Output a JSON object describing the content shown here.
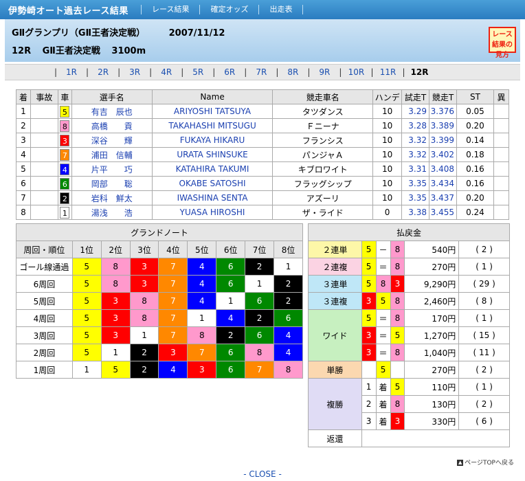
{
  "topbar": {
    "title": "伊勢崎オート過去レース結果",
    "links": [
      "レース結果",
      "確定オッズ",
      "出走表"
    ]
  },
  "header": {
    "event": "GⅡグランプリ（GⅡ王者決定戦）",
    "date": "2007/11/12",
    "race_no": "12R",
    "race_name": "GⅡ王者決定戦",
    "distance": "3100m",
    "guide_button": "レース結果の見方"
  },
  "races": [
    "1R",
    "2R",
    "3R",
    "4R",
    "5R",
    "6R",
    "7R",
    "8R",
    "9R",
    "10R",
    "11R",
    "12R"
  ],
  "current_race": "12R",
  "result": {
    "headers": [
      "着",
      "事故",
      "車",
      "選手名",
      "Name",
      "競走車名",
      "ハンデ",
      "試走T",
      "競走T",
      "ST",
      "異"
    ],
    "rows": [
      {
        "pos": "1",
        "acc": "",
        "car": "5",
        "rider": "有吉　辰也",
        "name": "ARIYOSHI TATSUYA",
        "machine": "タツダンス",
        "hande": "10",
        "trial": "3.29",
        "race": "3.376",
        "st": "0.05",
        "note": ""
      },
      {
        "pos": "2",
        "acc": "",
        "car": "8",
        "rider": "高橋　　貢",
        "name": "TAKAHASHI MITSUGU",
        "machine": "Ｆニーナ",
        "hande": "10",
        "trial": "3.28",
        "race": "3.389",
        "st": "0.20",
        "note": ""
      },
      {
        "pos": "3",
        "acc": "",
        "car": "3",
        "rider": "深谷　　輝",
        "name": "FUKAYA HIKARU",
        "machine": "フランシス",
        "hande": "10",
        "trial": "3.32",
        "race": "3.399",
        "st": "0.14",
        "note": ""
      },
      {
        "pos": "4",
        "acc": "",
        "car": "7",
        "rider": "浦田　信輔",
        "name": "URATA SHINSUKE",
        "machine": "パンジャＡ",
        "hande": "10",
        "trial": "3.32",
        "race": "3.402",
        "st": "0.18",
        "note": ""
      },
      {
        "pos": "5",
        "acc": "",
        "car": "4",
        "rider": "片平　　巧",
        "name": "KATAHIRA TAKUMI",
        "machine": "キブロワイト",
        "hande": "10",
        "trial": "3.31",
        "race": "3.408",
        "st": "0.16",
        "note": ""
      },
      {
        "pos": "6",
        "acc": "",
        "car": "6",
        "rider": "岡部　　聡",
        "name": "OKABE SATOSHI",
        "machine": "フラッグシップ",
        "hande": "10",
        "trial": "3.35",
        "race": "3.434",
        "st": "0.16",
        "note": ""
      },
      {
        "pos": "7",
        "acc": "",
        "car": "2",
        "rider": "岩科　鮮太",
        "name": "IWASHINA SENTA",
        "machine": "アズーリ",
        "hande": "10",
        "trial": "3.35",
        "race": "3.437",
        "st": "0.20",
        "note": ""
      },
      {
        "pos": "8",
        "acc": "",
        "car": "1",
        "rider": "湯浅　　浩",
        "name": "YUASA HIROSHI",
        "machine": "ザ・ライド",
        "hande": "0",
        "trial": "3.38",
        "race": "3.455",
        "st": "0.24",
        "note": ""
      }
    ]
  },
  "car_colors": {
    "1": {
      "bg": "#ffffff",
      "fg": "#000000"
    },
    "2": {
      "bg": "#000000",
      "fg": "#ffffff"
    },
    "3": {
      "bg": "#ff0000",
      "fg": "#ffffff"
    },
    "4": {
      "bg": "#0000ff",
      "fg": "#ffffff"
    },
    "5": {
      "bg": "#ffff00",
      "fg": "#000000"
    },
    "6": {
      "bg": "#008800",
      "fg": "#ffffff"
    },
    "7": {
      "bg": "#ff8800",
      "fg": "#ffffff"
    },
    "8": {
      "bg": "#ff99cc",
      "fg": "#000000"
    }
  },
  "grand_note": {
    "title": "グランドノート",
    "corner": "周回・順位",
    "positions": [
      "1位",
      "2位",
      "3位",
      "4位",
      "5位",
      "6位",
      "7位",
      "8位"
    ],
    "laps": [
      {
        "label": "ゴール線通過",
        "order": [
          "5",
          "8",
          "3",
          "7",
          "4",
          "6",
          "2",
          "1"
        ]
      },
      {
        "label": "6周回",
        "order": [
          "5",
          "8",
          "3",
          "7",
          "4",
          "6",
          "1",
          "2"
        ]
      },
      {
        "label": "5周回",
        "order": [
          "5",
          "3",
          "8",
          "7",
          "4",
          "1",
          "6",
          "2"
        ]
      },
      {
        "label": "4周回",
        "order": [
          "5",
          "3",
          "8",
          "7",
          "1",
          "4",
          "2",
          "6"
        ]
      },
      {
        "label": "3周回",
        "order": [
          "5",
          "3",
          "1",
          "7",
          "8",
          "2",
          "6",
          "4"
        ]
      },
      {
        "label": "2周回",
        "order": [
          "5",
          "1",
          "2",
          "3",
          "7",
          "6",
          "8",
          "4"
        ]
      },
      {
        "label": "1周回",
        "order": [
          "1",
          "5",
          "2",
          "4",
          "3",
          "6",
          "7",
          "8"
        ]
      }
    ]
  },
  "payout": {
    "title": "払戻金",
    "two_tan": {
      "label": "２連単",
      "c1": "5",
      "sym": "－",
      "c2": "8",
      "amount": "540円",
      "pop": "( 2 )"
    },
    "two_fuku": {
      "label": "２連複",
      "c1": "5",
      "sym": "＝",
      "c2": "8",
      "amount": "270円",
      "pop": "( 1 )"
    },
    "three_tan": {
      "label": "３連単",
      "c1": "5",
      "c2": "8",
      "c3": "3",
      "amount": "9,290円",
      "pop": "( 29 )"
    },
    "three_fuku": {
      "label": "３連複",
      "c1": "3",
      "c2": "5",
      "c3": "8",
      "amount": "2,460円",
      "pop": "( 8 )"
    },
    "wide": {
      "label": "ワイド",
      "rows": [
        {
          "c1": "5",
          "sym": "＝",
          "c2": "8",
          "amount": "170円",
          "pop": "( 1 )"
        },
        {
          "c1": "3",
          "sym": "＝",
          "c2": "5",
          "amount": "1,270円",
          "pop": "( 15 )"
        },
        {
          "c1": "3",
          "sym": "＝",
          "c2": "8",
          "amount": "1,040円",
          "pop": "( 11 )"
        }
      ]
    },
    "tansho": {
      "label": "単勝",
      "c1": "5",
      "amount": "270円",
      "pop": "( 2 )"
    },
    "fukusho": {
      "label": "複勝",
      "chaku": "着",
      "rows": [
        {
          "rank": "1",
          "c1": "5",
          "amount": "110円",
          "pop": "( 1 )"
        },
        {
          "rank": "2",
          "c1": "8",
          "amount": "130円",
          "pop": "( 2 )"
        },
        {
          "rank": "3",
          "c1": "3",
          "amount": "330円",
          "pop": "( 6 )"
        }
      ]
    },
    "refund": {
      "label": "返還"
    }
  },
  "label_colors": {
    "yellow": "#fdf7a8",
    "pink": "#fbd3e3",
    "cyan": "#bfe7f7",
    "green": "#c7f0c0",
    "peach": "#fbd8b0",
    "lavender": "#e0dcf5"
  },
  "footer": {
    "pagetop": "ページTOPへ戻る",
    "close": "- CLOSE -"
  }
}
